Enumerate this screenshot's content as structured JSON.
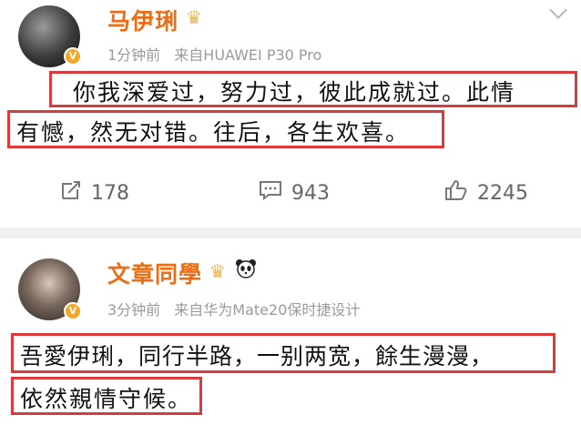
{
  "post1": {
    "username": "马伊琍",
    "vip_icon": "vip-crown-icon",
    "time": "1分钟前",
    "source": "来自HUAWEI P30 Pro",
    "text_line1": "你我深爱过，努力过，彼此成就过。此情",
    "text_line2": "有憾，然无对错。往后，各生欢喜。",
    "repost_count": "178",
    "comment_count": "943",
    "like_count": "2245"
  },
  "post2": {
    "username": "文章同學",
    "vip_icon": "vip-crown-icon",
    "panda_icon": "panda-icon",
    "time": "3分钟前",
    "source": "来自华为Mate20保时捷设计",
    "text_line1": "吾愛伊琍，同行半路，一别两宽，餘生漫漫，",
    "text_line2": "依然親情守候。"
  },
  "colors": {
    "username": "#ee6d14",
    "highlight_box": "#d93a3a",
    "meta": "#9a9a9a",
    "badge": "#f5a623"
  }
}
